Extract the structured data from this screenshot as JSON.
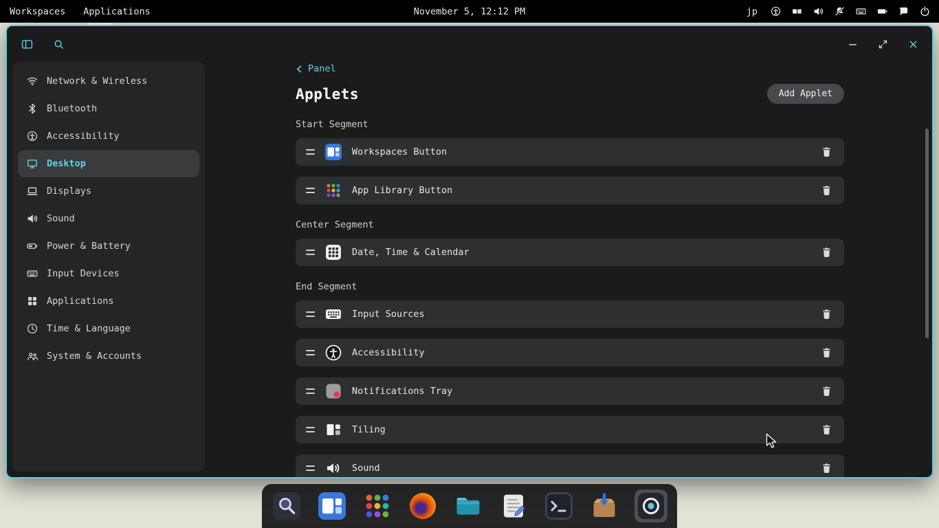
{
  "topbar": {
    "workspaces_label": "Workspaces",
    "applications_label": "Applications",
    "clock": "November 5, 12:12 PM",
    "input_source_label": "jp",
    "status_icons": [
      "accessibility-icon",
      "window-tiling-icon",
      "sound-icon",
      "notifications-disabled-icon",
      "keyboard-icon",
      "battery-icon",
      "chat-icon",
      "power-icon"
    ]
  },
  "window": {
    "colors": {
      "accent": "#58d0e1",
      "background": "#1b1b1c",
      "row_background": "#2e2f31",
      "sidebar_background": "#242526"
    },
    "titlebar": {
      "left_icons": [
        "sidebar-toggle-icon",
        "search-icon"
      ],
      "controls": [
        "minimize",
        "maximize",
        "close"
      ]
    },
    "sidebar": {
      "items": [
        {
          "label": "Network & Wireless",
          "icon": "wifi-icon",
          "selected": false
        },
        {
          "label": "Bluetooth",
          "icon": "bluetooth-icon",
          "selected": false
        },
        {
          "label": "Accessibility",
          "icon": "accessibility-icon",
          "selected": false
        },
        {
          "label": "Desktop",
          "icon": "desktop-icon",
          "selected": true
        },
        {
          "label": "Displays",
          "icon": "displays-icon",
          "selected": false
        },
        {
          "label": "Sound",
          "icon": "sound-icon",
          "selected": false
        },
        {
          "label": "Power & Battery",
          "icon": "battery-icon",
          "selected": false
        },
        {
          "label": "Input Devices",
          "icon": "keyboard-icon",
          "selected": false
        },
        {
          "label": "Applications",
          "icon": "apps-grid-icon",
          "selected": false
        },
        {
          "label": "Time & Language",
          "icon": "clock-icon",
          "selected": false
        },
        {
          "label": "System & Accounts",
          "icon": "users-icon",
          "selected": false
        }
      ]
    },
    "content": {
      "back_label": "Panel",
      "title": "Applets",
      "add_button_label": "Add Applet",
      "sections": [
        {
          "label": "Start Segment",
          "rows": [
            {
              "label": "Workspaces Button",
              "icon": "workspaces-applet-icon"
            },
            {
              "label": "App Library Button",
              "icon": "app-library-applet-icon"
            }
          ]
        },
        {
          "label": "Center Segment",
          "rows": [
            {
              "label": "Date, Time & Calendar",
              "icon": "calendar-applet-icon"
            }
          ]
        },
        {
          "label": "End Segment",
          "rows": [
            {
              "label": "Input Sources",
              "icon": "input-sources-applet-icon"
            },
            {
              "label": "Accessibility",
              "icon": "accessibility-applet-icon"
            },
            {
              "label": "Notifications Tray",
              "icon": "notifications-tray-applet-icon"
            },
            {
              "label": "Tiling",
              "icon": "tiling-applet-icon"
            },
            {
              "label": "Sound",
              "icon": "sound-applet-icon"
            }
          ]
        }
      ]
    }
  },
  "dock": {
    "items": [
      "launcher",
      "workspaces",
      "app-library",
      "firefox",
      "files",
      "text-editor",
      "terminal",
      "store",
      "settings"
    ],
    "active_item": "settings"
  }
}
